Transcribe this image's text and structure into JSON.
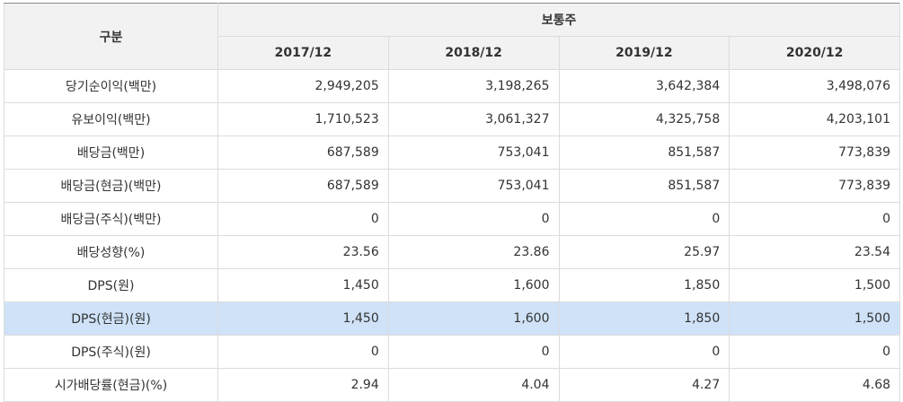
{
  "header": {
    "category_label": "구분",
    "group_label": "보통주",
    "years": [
      "2017/12",
      "2018/12",
      "2019/12",
      "2020/12"
    ]
  },
  "rows": [
    {
      "label": "당기순이익(백만)",
      "values": [
        "2,949,205",
        "3,198,265",
        "3,642,384",
        "3,498,076"
      ]
    },
    {
      "label": "유보이익(백만)",
      "values": [
        "1,710,523",
        "3,061,327",
        "4,325,758",
        "4,203,101"
      ]
    },
    {
      "label": "배당금(백만)",
      "values": [
        "687,589",
        "753,041",
        "851,587",
        "773,839"
      ]
    },
    {
      "label": "배당금(현금)(백만)",
      "values": [
        "687,589",
        "753,041",
        "851,587",
        "773,839"
      ]
    },
    {
      "label": "배당금(주식)(백만)",
      "values": [
        "0",
        "0",
        "0",
        "0"
      ]
    },
    {
      "label": "배당성향(%)",
      "values": [
        "23.56",
        "23.86",
        "25.97",
        "23.54"
      ]
    },
    {
      "label": "DPS(원)",
      "values": [
        "1,450",
        "1,600",
        "1,850",
        "1,500"
      ]
    },
    {
      "label": "DPS(현금)(원)",
      "values": [
        "1,450",
        "1,600",
        "1,850",
        "1,500"
      ],
      "selected": true
    },
    {
      "label": "DPS(주식)(원)",
      "values": [
        "0",
        "0",
        "0",
        "0"
      ]
    },
    {
      "label": "시가배당률(현금)(%)",
      "values": [
        "2.94",
        "4.04",
        "4.27",
        "4.68"
      ]
    }
  ],
  "colors": {
    "header_bg": "#f2f2f2",
    "selected_row": "#cfe2f8",
    "border": "#dcdcdc"
  }
}
